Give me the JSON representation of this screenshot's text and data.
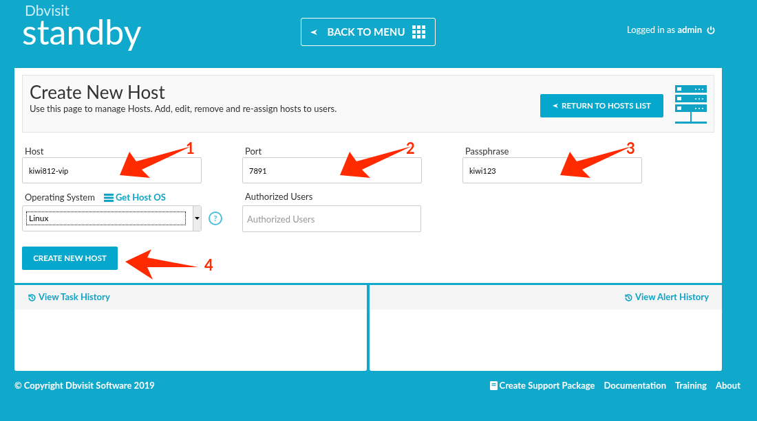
{
  "logo": {
    "brand": "Dbvisit",
    "product": "standby"
  },
  "header": {
    "back_button": "BACK TO MENU",
    "logged_in_prefix": "Logged in as",
    "user": "admin"
  },
  "page": {
    "title": "Create New Host",
    "subtitle": "Use this page to manage Hosts. Add, edit, remove and re-assign hosts to users.",
    "return_button": "RETURN TO HOSTS LIST"
  },
  "fields": [
    {
      "label": "Host",
      "value": "kiwi812-vip",
      "annotation": "1"
    },
    {
      "label": "Port",
      "value": "7891",
      "annotation": "2"
    },
    {
      "label": "Passphrase",
      "value": "kiwi123",
      "annotation": "3"
    }
  ],
  "os": {
    "label": "Operating System",
    "link": "Get Host OS",
    "value": "Linux",
    "help": "?"
  },
  "authorized_users": {
    "label": "Authorized Users",
    "placeholder": "Authorized Users"
  },
  "create_button": {
    "label": "CREATE NEW HOST",
    "annotation": "4"
  },
  "panels": [
    {
      "link": "View Task History"
    },
    {
      "link": "View Alert History"
    }
  ],
  "footer": {
    "copyright": "© Copyright Dbvisit Software 2019",
    "links": [
      "Create Support Package",
      "Documentation",
      "Training",
      "About"
    ]
  }
}
